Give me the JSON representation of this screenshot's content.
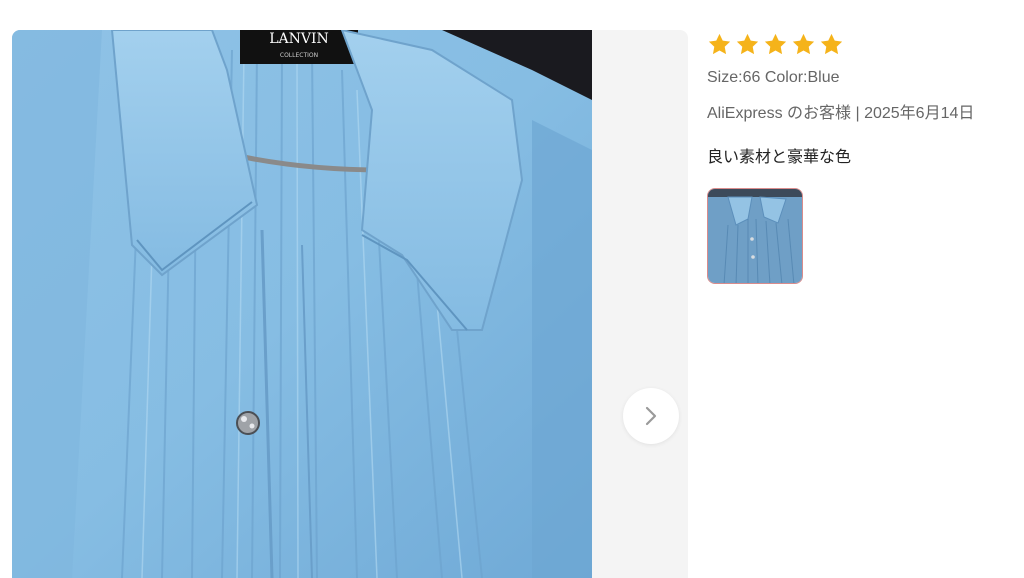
{
  "gallery": {
    "main_image": "blue-pleated-blouse-photo",
    "label_text": "LANVIN",
    "label_subtext": "COLLECTION",
    "next_icon": "chevron-right-icon"
  },
  "review": {
    "rating": 5,
    "max_rating": 5,
    "star_color": "#f5b31a",
    "sku": "Size:66 Color:Blue",
    "author_date": "AliExpress のお客様 | 2025年6月14日",
    "text": "良い素材と豪華な色",
    "thumbnail": "blue-pleated-blouse-thumbnail"
  }
}
